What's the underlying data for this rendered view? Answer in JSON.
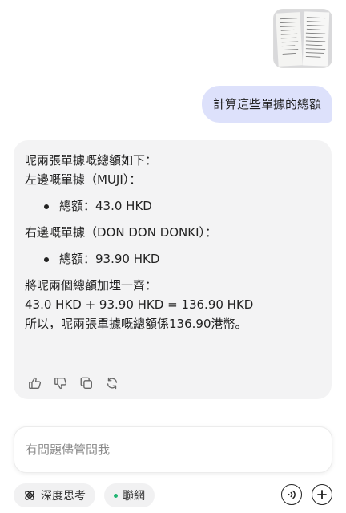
{
  "thumbnail": {
    "alt": "receipts-photo"
  },
  "user_message": "計算這些單據的總額",
  "assistant": {
    "intro_line1": "呢兩張單據嘅總額如下：",
    "left_heading": "左邊嘅單據（MUJI）：",
    "left_bullet": "總額：43.0 HKD",
    "right_heading": "右邊嘅單據（DON DON DONKI）：",
    "right_bullet": "總額：93.90 HKD",
    "sum_intro": "將呢兩個總額加埋一齊：",
    "equation": "43.0 HKD + 93.90 HKD = 136.90 HKD",
    "conclusion": "所以，呢兩張單據嘅總額係136.90港幣。"
  },
  "composer": {
    "placeholder": "有問題儘管問我"
  },
  "toolbar": {
    "deep_think_label": "深度思考",
    "web_label": "聯網"
  },
  "colors": {
    "user_bubble": "#dde1fb",
    "reply_card": "#f3f3f4",
    "web_dot": "#22b573"
  }
}
